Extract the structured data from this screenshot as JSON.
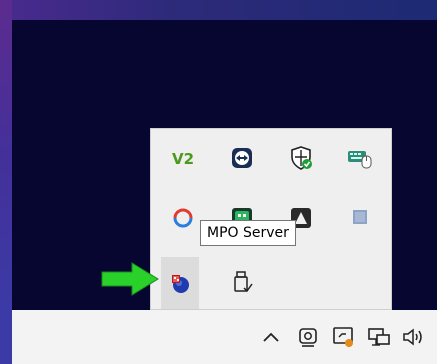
{
  "tooltip": {
    "text": "MPO Server"
  },
  "tray_overflow": {
    "icons": [
      {
        "name": "veeam-icon",
        "label": "V2"
      },
      {
        "name": "teamviewer-icon"
      },
      {
        "name": "windows-security-icon"
      },
      {
        "name": "keyboard-mouse-icon"
      },
      {
        "name": "sync-icon"
      },
      {
        "name": "meet-icon"
      },
      {
        "name": "app-icon"
      },
      {
        "name": "note-icon"
      },
      {
        "name": "mpo-server-icon"
      },
      {
        "name": "usb-eject-icon"
      }
    ]
  },
  "taskbar": {
    "icons": [
      {
        "name": "chevron-up-icon"
      },
      {
        "name": "camera-icon"
      },
      {
        "name": "display-icon"
      },
      {
        "name": "network-icon"
      },
      {
        "name": "volume-icon"
      }
    ]
  },
  "colors": {
    "arrow": "#2bd12b",
    "panel_bg": "#efefef",
    "taskbar_bg": "#f3f3f3",
    "desktop_bg": "#060630"
  }
}
